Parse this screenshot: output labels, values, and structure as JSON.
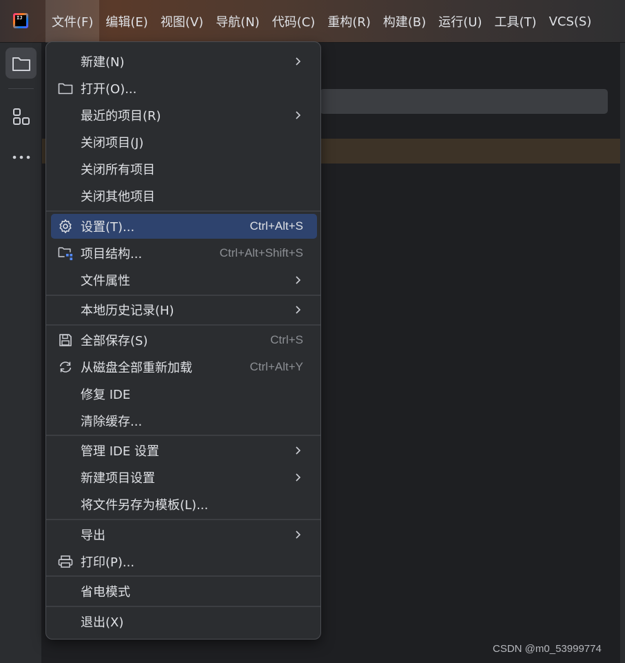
{
  "menubar": {
    "items": [
      "文件(F)",
      "编辑(E)",
      "视图(V)",
      "导航(N)",
      "代码(C)",
      "重构(R)",
      "构建(B)",
      "运行(U)",
      "工具(T)",
      "VCS(S)"
    ],
    "active_index": 0
  },
  "app": {
    "logo_text": "IJ"
  },
  "file_menu": {
    "items": [
      {
        "label": "新建(N)",
        "icon": "",
        "shortcut": "",
        "submenu": true
      },
      {
        "label": "打开(O)...",
        "icon": "folder-icon",
        "shortcut": "",
        "submenu": false
      },
      {
        "label": "最近的项目(R)",
        "icon": "",
        "shortcut": "",
        "submenu": true
      },
      {
        "label": "关闭项目(J)",
        "icon": "",
        "shortcut": "",
        "submenu": false
      },
      {
        "label": "关闭所有项目",
        "icon": "",
        "shortcut": "",
        "submenu": false
      },
      {
        "label": "关闭其他项目",
        "icon": "",
        "shortcut": "",
        "submenu": false
      },
      {
        "label": "设置(T)...",
        "icon": "gear-icon",
        "shortcut": "Ctrl+Alt+S",
        "submenu": false,
        "selected": true
      },
      {
        "label": "项目结构...",
        "icon": "project-structure-icon",
        "shortcut": "Ctrl+Alt+Shift+S",
        "submenu": false
      },
      {
        "label": "文件属性",
        "icon": "",
        "shortcut": "",
        "submenu": true
      },
      {
        "label": "本地历史记录(H)",
        "icon": "",
        "shortcut": "",
        "submenu": true
      },
      {
        "label": "全部保存(S)",
        "icon": "save-icon",
        "shortcut": "Ctrl+S",
        "submenu": false
      },
      {
        "label": "从磁盘全部重新加载",
        "icon": "reload-icon",
        "shortcut": "Ctrl+Alt+Y",
        "submenu": false
      },
      {
        "label": "修复 IDE",
        "icon": "",
        "shortcut": "",
        "submenu": false
      },
      {
        "label": "清除缓存...",
        "icon": "",
        "shortcut": "",
        "submenu": false
      },
      {
        "label": "管理 IDE 设置",
        "icon": "",
        "shortcut": "",
        "submenu": true
      },
      {
        "label": "新建项目设置",
        "icon": "",
        "shortcut": "",
        "submenu": true
      },
      {
        "label": "将文件另存为模板(L)...",
        "icon": "",
        "shortcut": "",
        "submenu": false
      },
      {
        "label": "导出",
        "icon": "",
        "shortcut": "",
        "submenu": true
      },
      {
        "label": "打印(P)...",
        "icon": "printer-icon",
        "shortcut": "",
        "submenu": false
      },
      {
        "label": "省电模式",
        "icon": "",
        "shortcut": "",
        "submenu": false
      },
      {
        "label": "退出(X)",
        "icon": "",
        "shortcut": "",
        "submenu": false
      }
    ]
  },
  "watermark": "CSDN @m0_53999774",
  "colors": {
    "background": "#1e1f22",
    "menu_bg": "#2b2d30",
    "selected": "#2e436e",
    "text": "#dfe1e5",
    "shortcut_text": "#8c8f94"
  }
}
